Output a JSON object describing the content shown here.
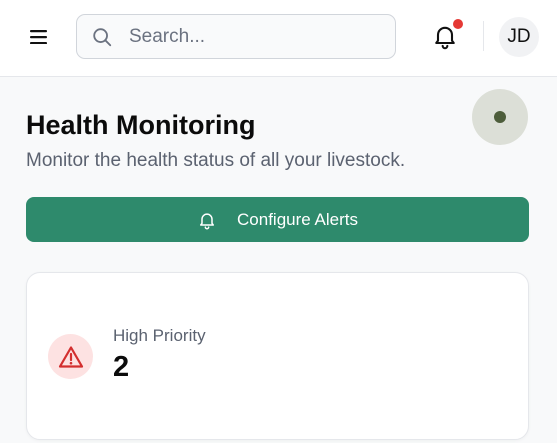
{
  "header": {
    "search": {
      "placeholder": "Search...",
      "value": ""
    },
    "notifications": {
      "has_unread": true
    },
    "user": {
      "initials": "JD"
    }
  },
  "page": {
    "title": "Health Monitoring",
    "subtitle": "Monitor the health status of all your livestock."
  },
  "actions": {
    "configure_alerts_label": "Configure Alerts"
  },
  "stats": [
    {
      "label": "High Priority",
      "value": "2",
      "icon": "alert-triangle-icon"
    }
  ],
  "colors": {
    "primary": "#2e8a6c",
    "alert": "#d32f2f",
    "alert_bg": "#fde2e2",
    "notification_dot": "#e53935"
  }
}
